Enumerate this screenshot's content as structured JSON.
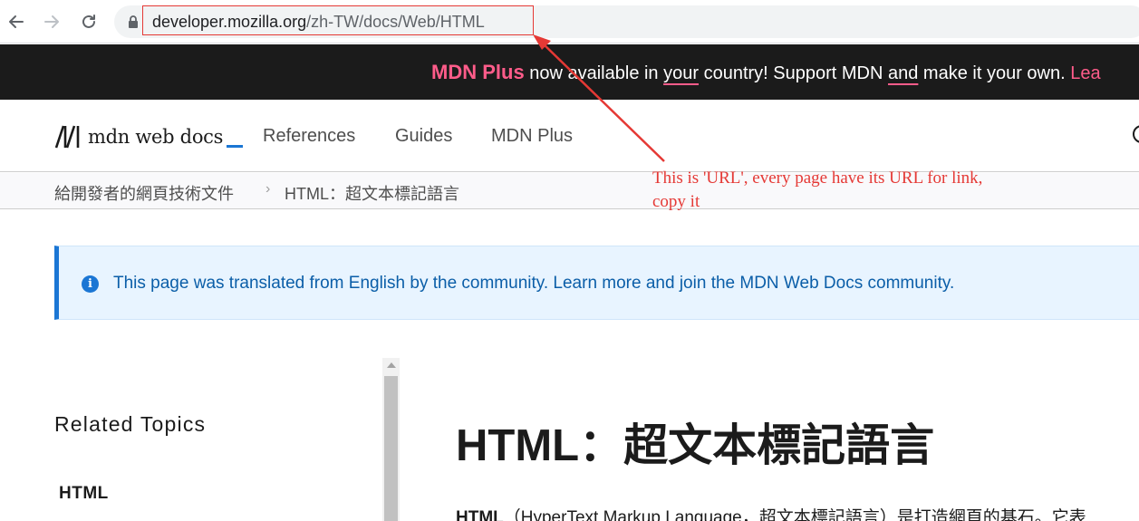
{
  "browser": {
    "url_host": "developer.mozilla.org",
    "url_path": "/zh-TW/docs/Web/HTML",
    "icons": {
      "back": "arrow-left-icon",
      "forward": "arrow-right-icon",
      "reload": "reload-icon",
      "lock": "lock-icon"
    }
  },
  "banner": {
    "plus": "MDN Plus",
    "t1": " now available in ",
    "u1": "your",
    "t2": " country! Support MDN ",
    "u2": "and",
    "t3": " make it your own. ",
    "learn": "Lea"
  },
  "header": {
    "logo_text": "mdn web docs",
    "menu": [
      "References",
      "Guides",
      "MDN Plus"
    ]
  },
  "breadcrumbs": [
    "給開發者的網頁技術文件",
    "HTML：超文本標記語言"
  ],
  "notice": {
    "text": "This page was translated from English by the community. Learn more and join the MDN Web Docs community."
  },
  "sidebar": {
    "heading": "Related Topics",
    "first_item": "HTML"
  },
  "main": {
    "title": "HTML：超文本標記語言",
    "intro_bold": "HTML",
    "intro_rest": "（HyperText Markup Language，超文本標記語言）是打造網頁的基石。它表"
  },
  "annotation": {
    "line1": "This is 'URL', every page have its URL for link,",
    "line2": "copy it"
  },
  "colors": {
    "accent_red": "#e53935",
    "mdn_plus_pink": "#ff5c8a",
    "mdn_blue": "#1b76d4",
    "banner_bg": "#1b1b1b"
  }
}
